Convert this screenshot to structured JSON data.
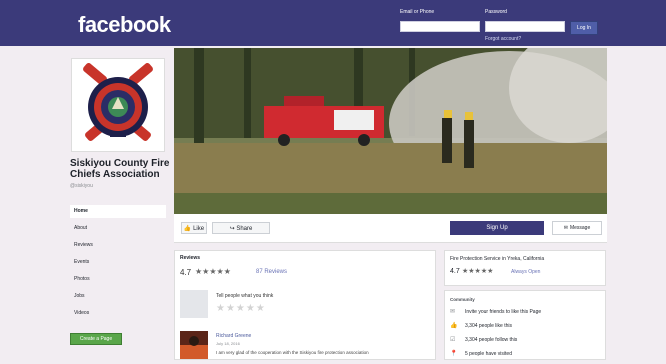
{
  "header": {
    "logo": "facebook",
    "email_label": "Email or Phone",
    "password_label": "Password",
    "login_button": "Log In",
    "forgot_link": "Forgot account?"
  },
  "page": {
    "name": "Siskiyou County Fire Chiefs Association",
    "handle": "@siskiyou"
  },
  "nav": {
    "items": [
      "Home",
      "About",
      "Reviews",
      "Events",
      "Photos",
      "Jobs",
      "Videos"
    ],
    "create_page": "Create a Page"
  },
  "actions": {
    "like": "Like",
    "share": "Share",
    "signup": "Sign Up",
    "message": "Message"
  },
  "reviews": {
    "title": "Reviews",
    "score": "4.7",
    "stars": "★★★★★",
    "count": "87 Reviews",
    "prompt": "Tell people what you think",
    "empty_stars": "★★★★★",
    "reviewer_name": "Richard Greene",
    "reviewer_date": "July 18, 2016",
    "reviewer_text": "I am very glad of the cooperation with the Siskiyou fire protection association"
  },
  "side_business": {
    "title": "Fire Protection Service in Yreka, California",
    "score": "4.7",
    "stars": "★★★★★",
    "count": "Always Open"
  },
  "community": {
    "title": "Community",
    "items": [
      {
        "icon": "invite-icon",
        "glyph": "✉",
        "text": "Invite your friends to like this Page"
      },
      {
        "icon": "like-icon",
        "glyph": "👍",
        "text": "3,304 people like this"
      },
      {
        "icon": "follow-icon",
        "glyph": "☑",
        "text": "3,304 people follow this"
      },
      {
        "icon": "checkin-icon",
        "glyph": "📍",
        "text": "5 people have visited"
      }
    ]
  },
  "colors": {
    "brand": "#3b3a7a",
    "signup": "#3b3a7a",
    "create_page": "#5aa64a"
  }
}
